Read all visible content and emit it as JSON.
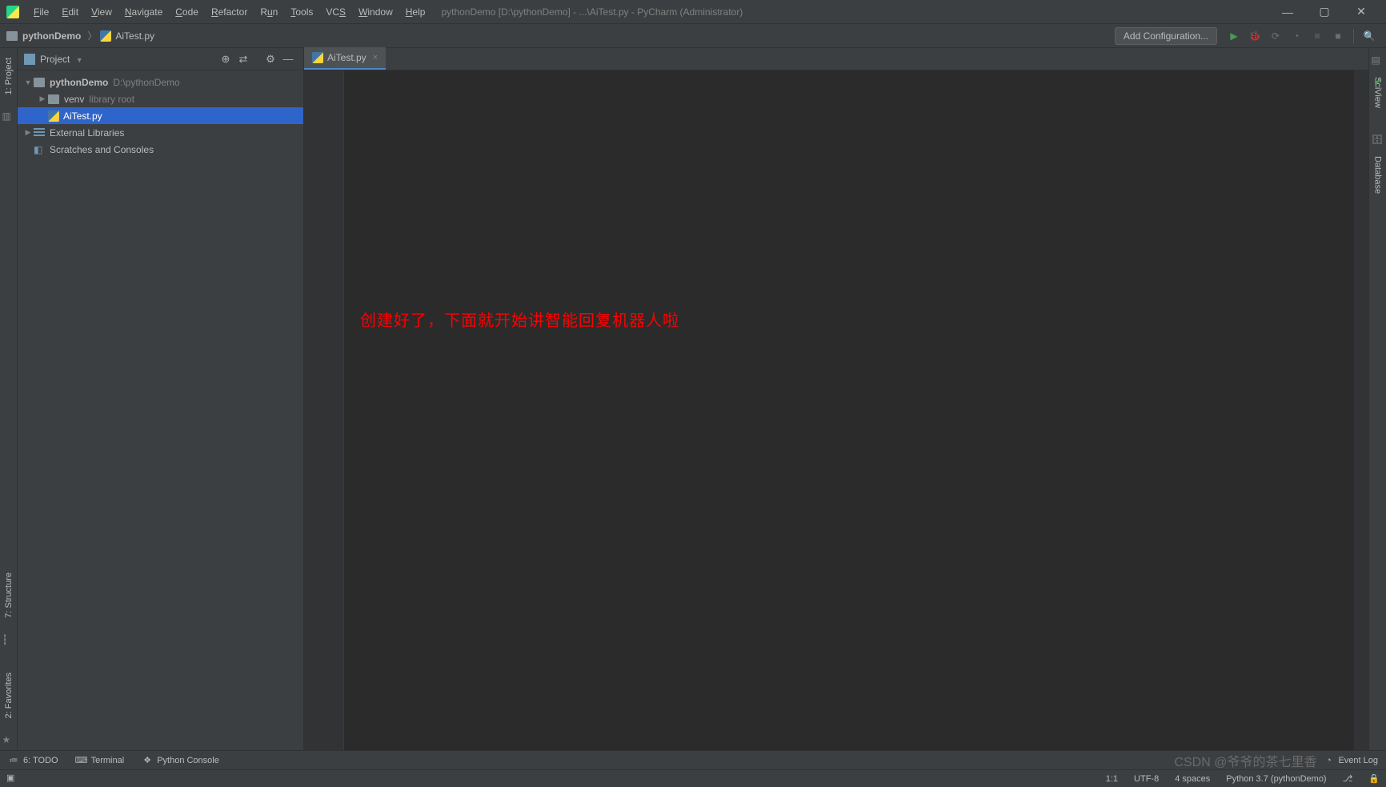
{
  "window": {
    "title": "pythonDemo [D:\\pythonDemo] - ...\\AiTest.py - PyCharm (Administrator)"
  },
  "menu": {
    "file": "File",
    "edit": "Edit",
    "view": "View",
    "navigate": "Navigate",
    "code": "Code",
    "refactor": "Refactor",
    "run": "Run",
    "tools": "Tools",
    "vcs": "VCS",
    "window": "Window",
    "help": "Help"
  },
  "breadcrumbs": {
    "project": "pythonDemo",
    "file": "AiTest.py"
  },
  "toolbar": {
    "add_config": "Add Configuration..."
  },
  "project_panel": {
    "title": "Project",
    "root_name": "pythonDemo",
    "root_path": "D:\\pythonDemo",
    "venv": "venv",
    "venv_hint": "library root",
    "file": "AiTest.py",
    "external": "External Libraries",
    "scratches": "Scratches and Consoles"
  },
  "tabs": {
    "file": "AiTest.py"
  },
  "annotation": "创建好了，下面就开始讲智能回复机器人啦",
  "left_rail": {
    "project": "1: Project",
    "structure": "7: Structure",
    "favorites": "2: Favorites"
  },
  "right_rail": {
    "sciview": "SciView",
    "database": "Database"
  },
  "bottom_tabs": {
    "todo": "6: TODO",
    "terminal": "Terminal",
    "pyconsole": "Python Console",
    "event_log": "Event Log"
  },
  "watermark": "CSDN @爷爷的茶七里香",
  "status": {
    "pos": "1:1",
    "encoding": "UTF-8",
    "indent": "4 spaces",
    "interpreter": "Python 3.7 (pythonDemo)"
  }
}
